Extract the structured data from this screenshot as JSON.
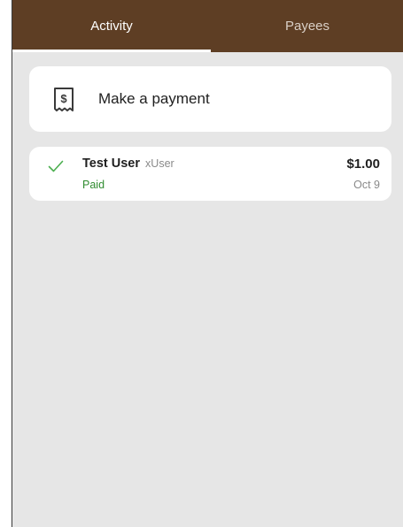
{
  "tabs": {
    "activity": "Activity",
    "payees": "Payees",
    "selected": "Activity"
  },
  "make_payment": {
    "label": "Make a payment",
    "icon": "receipt-dollar-icon"
  },
  "activity": [
    {
      "name": "Test User",
      "handle": "xUser",
      "status": "Paid",
      "amount": "$1.00",
      "date": "Oct 9",
      "icon": "check-icon"
    }
  ],
  "colors": {
    "header": "#5e3e24",
    "background": "#e6e6e6",
    "paid": "#2e8b2e",
    "check": "#4caf50"
  }
}
